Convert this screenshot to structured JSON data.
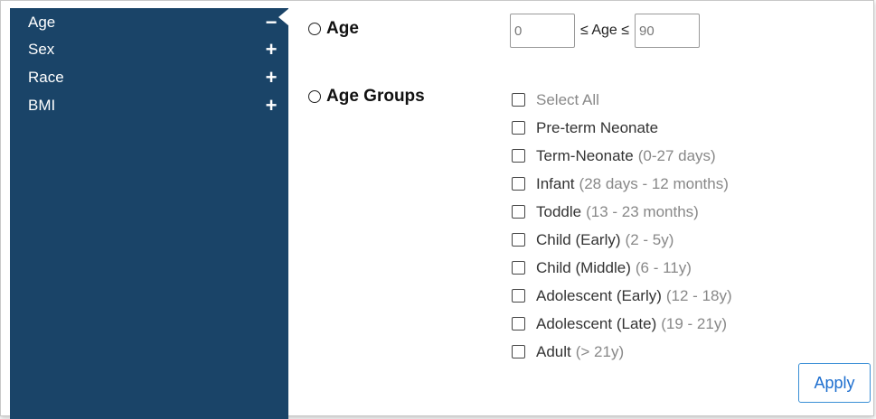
{
  "sidebar": {
    "items": [
      {
        "label": "Age",
        "toggle": "−"
      },
      {
        "label": "Sex",
        "toggle": "+"
      },
      {
        "label": "Race",
        "toggle": "+"
      },
      {
        "label": "BMI",
        "toggle": "+"
      }
    ]
  },
  "modes": {
    "age_label": "Age",
    "groups_label": "Age Groups"
  },
  "age_range": {
    "min_value": "0",
    "max_value": "90",
    "separator": "≤ Age ≤"
  },
  "groups": {
    "select_all": "Select All",
    "items": [
      {
        "name": "Pre-term Neonate",
        "range": ""
      },
      {
        "name": "Term-Neonate",
        "range": "(0-27 days)"
      },
      {
        "name": "Infant",
        "range": "(28 days - 12 months)"
      },
      {
        "name": "Toddle",
        "range": "(13 - 23 months)"
      },
      {
        "name": "Child (Early)",
        "range": "(2 - 5y)"
      },
      {
        "name": "Child (Middle)",
        "range": "(6 - 11y)"
      },
      {
        "name": "Adolescent (Early)",
        "range": "(12 - 18y)"
      },
      {
        "name": "Adolescent (Late)",
        "range": "(19 - 21y)"
      },
      {
        "name": "Adult",
        "range": "(> 21y)"
      }
    ]
  },
  "actions": {
    "apply_label": "Apply"
  },
  "colors": {
    "sidebar_bg": "#1a4468",
    "accent": "#1e6fcf"
  }
}
